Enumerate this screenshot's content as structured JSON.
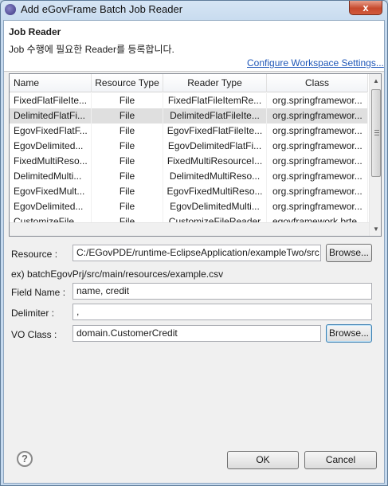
{
  "window": {
    "title": "Add eGovFrame Batch Job Reader",
    "close_label": "x"
  },
  "header": {
    "title": "Job Reader",
    "description": "Job 수행에 필요한 Reader를 등록합니다.",
    "configure_link": "Configure Workspace Settings..."
  },
  "table": {
    "columns": [
      "Name",
      "Resource Type",
      "Reader Type",
      "Class"
    ],
    "rows": [
      [
        "FixedFlatFileIte...",
        "File",
        "FixedFlatFileItemRe...",
        "org.springframewor..."
      ],
      [
        "DelimitedFlatFi...",
        "File",
        "DelimitedFlatFileIte...",
        "org.springframewor..."
      ],
      [
        "EgovFixedFlatF...",
        "File",
        "EgovFixedFlatFileIte...",
        "org.springframewor..."
      ],
      [
        "EgovDelimited...",
        "File",
        "EgovDelimitedFlatFi...",
        "org.springframewor..."
      ],
      [
        "FixedMultiReso...",
        "File",
        "FixedMultiResourceI...",
        "org.springframewor..."
      ],
      [
        "DelimitedMulti...",
        "File",
        "DelimitedMultiReso...",
        "org.springframewor..."
      ],
      [
        "EgovFixedMult...",
        "File",
        "EgovFixedMultiReso...",
        "org.springframewor..."
      ],
      [
        "EgovDelimited...",
        "File",
        "EgovDelimitedMulti...",
        "org.springframewor..."
      ],
      [
        "CustomizeFile...",
        "File",
        "CustomizeFileReader",
        "egovframework.brte..."
      ]
    ],
    "selected_row": 1
  },
  "form": {
    "resource_label": "Resource :",
    "resource_value": "C:/EGovPDE/runtime-EclipseApplication/exampleTwo/src",
    "browse_label": "Browse...",
    "resource_hint": "ex) batchEgovPrj/src/main/resources/example.csv",
    "field_name_label": "Field Name :",
    "field_name_value": "name, credit",
    "delimiter_label": "Delimiter :",
    "delimiter_value": ",",
    "vo_class_label": "VO Class :",
    "vo_class_value": "domain.CustomerCredit",
    "vo_browse_label": "Browse..."
  },
  "footer": {
    "help_label": "?",
    "ok_label": "OK",
    "cancel_label": "Cancel"
  }
}
